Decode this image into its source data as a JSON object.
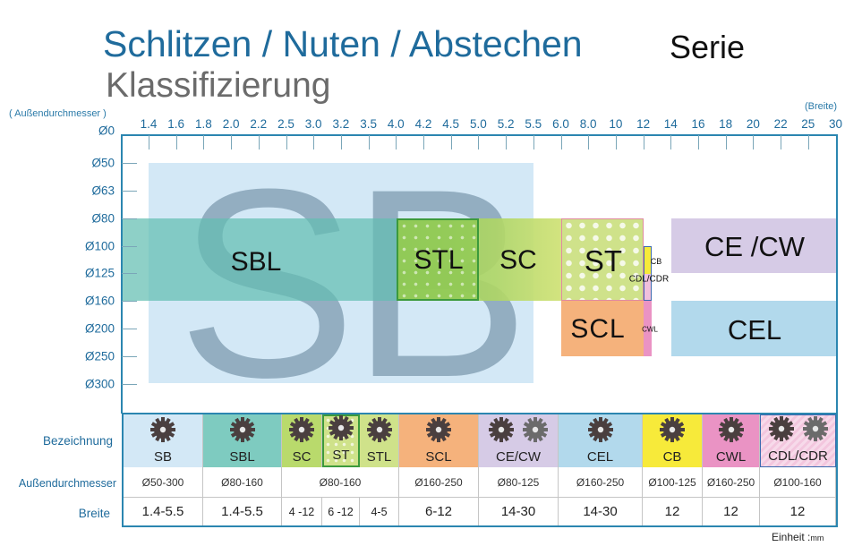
{
  "header": {
    "title": "Schlitzen / Nuten / Abstechen",
    "title_suffix": "Serie",
    "subtitle": "Klassifizierung"
  },
  "colors": {
    "title_blue": "#1f6b9c",
    "axis_blue": "#2b86b0",
    "SB": "#d3e8f6",
    "SBL": "#7ecbc0",
    "STL": "#9fcd5a",
    "SC": "#b9da6c",
    "ST": "#cfe28a",
    "SCL": "#f5b27c",
    "CE_CW": "#d6cbe6",
    "CEL": "#b2d9ec",
    "CB": "#f7ea3a",
    "CWL": "#ea93c4",
    "CDL_CDR": "#f3c6de"
  },
  "chart_data": {
    "type": "heatmap",
    "title": "Schlitzen / Nuten / Abstechen Serie Klassifizierung",
    "xlabel": "(Breite)",
    "ylabel": "( Außendurchmesser )",
    "x_axis_position": "top",
    "x_ticks": [
      "1.4",
      "1.6",
      "1.8",
      "2.0",
      "2.2",
      "2.5",
      "3.0",
      "3.2",
      "3.5",
      "4.0",
      "4.2",
      "4.5",
      "5.0",
      "5.2",
      "5.5",
      "6.0",
      "8.0",
      "10",
      "12",
      "14",
      "16",
      "18",
      "20",
      "22",
      "25",
      "30"
    ],
    "y_ticks": [
      "Ø0",
      "Ø50",
      "Ø63",
      "Ø80",
      "Ø100",
      "Ø125",
      "Ø160",
      "Ø200",
      "Ø250",
      "Ø300"
    ],
    "regions": [
      {
        "name": "SB",
        "width_range": [
          1.4,
          5.5
        ],
        "diameter_range": [
          50,
          300
        ]
      },
      {
        "name": "SBL",
        "width_range": [
          1.4,
          5.5
        ],
        "diameter_range": [
          80,
          160
        ]
      },
      {
        "name": "STL",
        "width_range": [
          4.0,
          5.0
        ],
        "diameter_range": [
          80,
          160
        ]
      },
      {
        "name": "SC",
        "width_range": [
          4.0,
          12
        ],
        "diameter_range": [
          80,
          160
        ]
      },
      {
        "name": "ST",
        "width_range": [
          6.0,
          12
        ],
        "diameter_range": [
          80,
          160
        ]
      },
      {
        "name": "CB",
        "width_range": [
          12,
          12
        ],
        "diameter_range": [
          100,
          125
        ]
      },
      {
        "name": "CDL/CDR",
        "width_range": [
          12,
          12
        ],
        "diameter_range": [
          100,
          160
        ]
      },
      {
        "name": "SCL",
        "width_range": [
          6.0,
          12
        ],
        "diameter_range": [
          160,
          250
        ]
      },
      {
        "name": "CWL",
        "width_range": [
          12,
          12
        ],
        "diameter_range": [
          160,
          250
        ]
      },
      {
        "name": "CE /CW",
        "width_range": [
          14,
          30
        ],
        "diameter_range": [
          80,
          125
        ]
      },
      {
        "name": "CEL",
        "width_range": [
          14,
          30
        ],
        "diameter_range": [
          160,
          250
        ]
      }
    ],
    "watermark": "SB"
  },
  "table": {
    "row_labels": {
      "name": "Bezeichnung",
      "diameter": "Außendurchmesser",
      "width": "Breite"
    },
    "columns": [
      {
        "name": "SB",
        "diameter": "Ø50-300",
        "width": "1.4-5.5"
      },
      {
        "name": "SBL",
        "diameter": "Ø80-160",
        "width": "1.4-5.5"
      },
      {
        "name": "SC",
        "diameter": "Ø80-160",
        "width": "4 -12"
      },
      {
        "name": "ST",
        "diameter": "",
        "width": "6 -12"
      },
      {
        "name": "STL",
        "diameter": "",
        "width": "4-5"
      },
      {
        "name": "SCL",
        "diameter": "Ø160-250",
        "width": "6-12"
      },
      {
        "name": "CE/CW",
        "diameter": "Ø80-125",
        "width": "14-30"
      },
      {
        "name": "CEL",
        "diameter": "Ø160-250",
        "width": "14-30"
      },
      {
        "name": "CB",
        "diameter": "Ø100-125",
        "width": "12"
      },
      {
        "name": "CWL",
        "diameter": "Ø160-250",
        "width": "12"
      },
      {
        "name": "CDL/CDR",
        "diameter": "Ø100-160",
        "width": "12"
      }
    ],
    "unit_label": "Einheit :",
    "unit": "mm"
  }
}
